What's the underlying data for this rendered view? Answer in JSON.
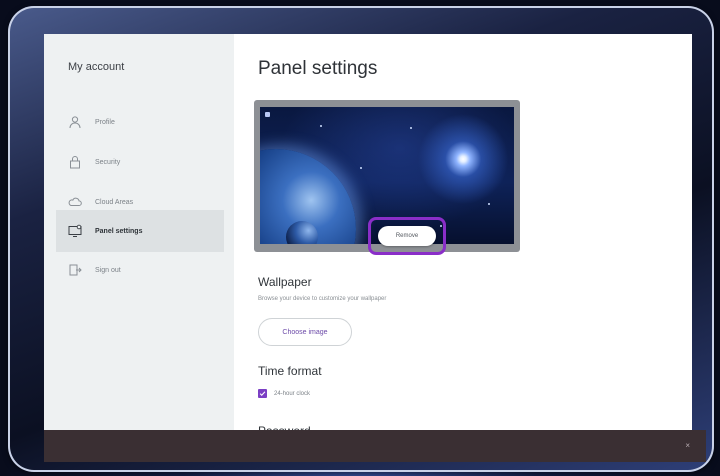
{
  "sidebar": {
    "title": "My account",
    "items": [
      {
        "label": "Profile",
        "icon": "person-icon"
      },
      {
        "label": "Security",
        "icon": "lock-icon"
      },
      {
        "label": "Cloud Areas",
        "icon": "cloud-icon"
      },
      {
        "label": "Panel settings",
        "icon": "panel-settings-icon",
        "active": true
      },
      {
        "label": "Sign out",
        "icon": "sign-out-icon"
      }
    ]
  },
  "main": {
    "title": "Panel settings",
    "preview": {
      "remove_label": "Remove"
    },
    "wallpaper": {
      "title": "Wallpaper",
      "description": "Browse your device to customize your wallpaper",
      "choose_label": "Choose image"
    },
    "time_format": {
      "title": "Time format",
      "checkbox_label": "24-hour clock",
      "checked": true
    },
    "next_section_title": "Password"
  },
  "colors": {
    "accent": "#7b3fc4",
    "highlight": "#8a2ec8",
    "sidebar_bg": "#eef1f2",
    "bottom_bar": "#3a2f33"
  },
  "bottom_bar": {
    "close_glyph": "×"
  }
}
